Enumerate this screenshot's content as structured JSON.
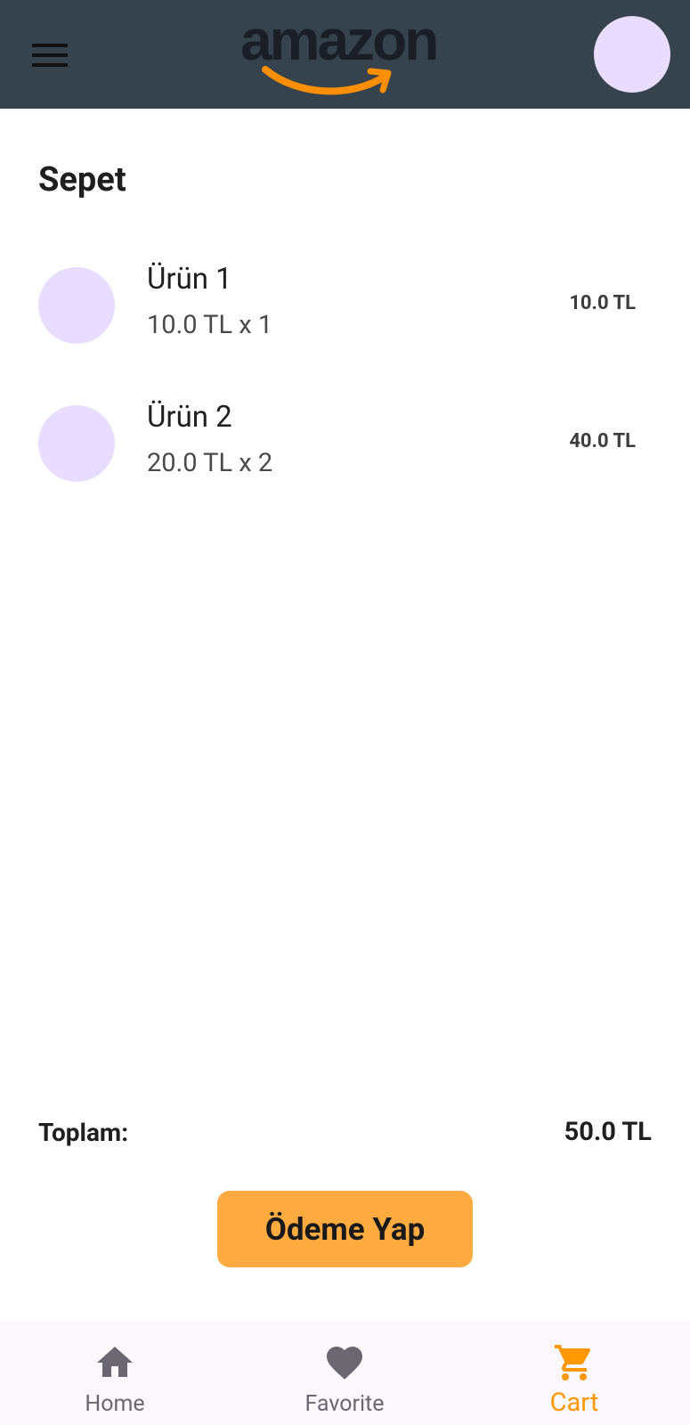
{
  "app_bar": {
    "logo_text": "amazon",
    "menu_icon": "hamburger-menu-icon",
    "avatar": "profile-avatar"
  },
  "page": {
    "title": "Sepet"
  },
  "cart": {
    "items": [
      {
        "name": "Ürün 1",
        "qty_line": "10.0 TL x 1",
        "total": "10.0 TL"
      },
      {
        "name": "Ürün 2",
        "qty_line": "20.0 TL x 2",
        "total": "40.0 TL"
      }
    ],
    "total_label": "Toplam:",
    "total_value": "50.0 TL",
    "pay_button_label": "Ödeme Yap"
  },
  "bottom_nav": {
    "items": [
      {
        "label": "Home",
        "icon": "home-icon",
        "active": false
      },
      {
        "label": "Favorite",
        "icon": "heart-icon",
        "active": false
      },
      {
        "label": "Cart",
        "icon": "cart-icon",
        "active": true
      }
    ]
  },
  "colors": {
    "app_bar_bg": "#36424c",
    "accent": "#ff9800",
    "pay_button_bg": "#ffab40",
    "avatar_placeholder": "#e9ddff",
    "nav_bg": "#fcf6fd",
    "logo_smile": "#ff8f00"
  }
}
